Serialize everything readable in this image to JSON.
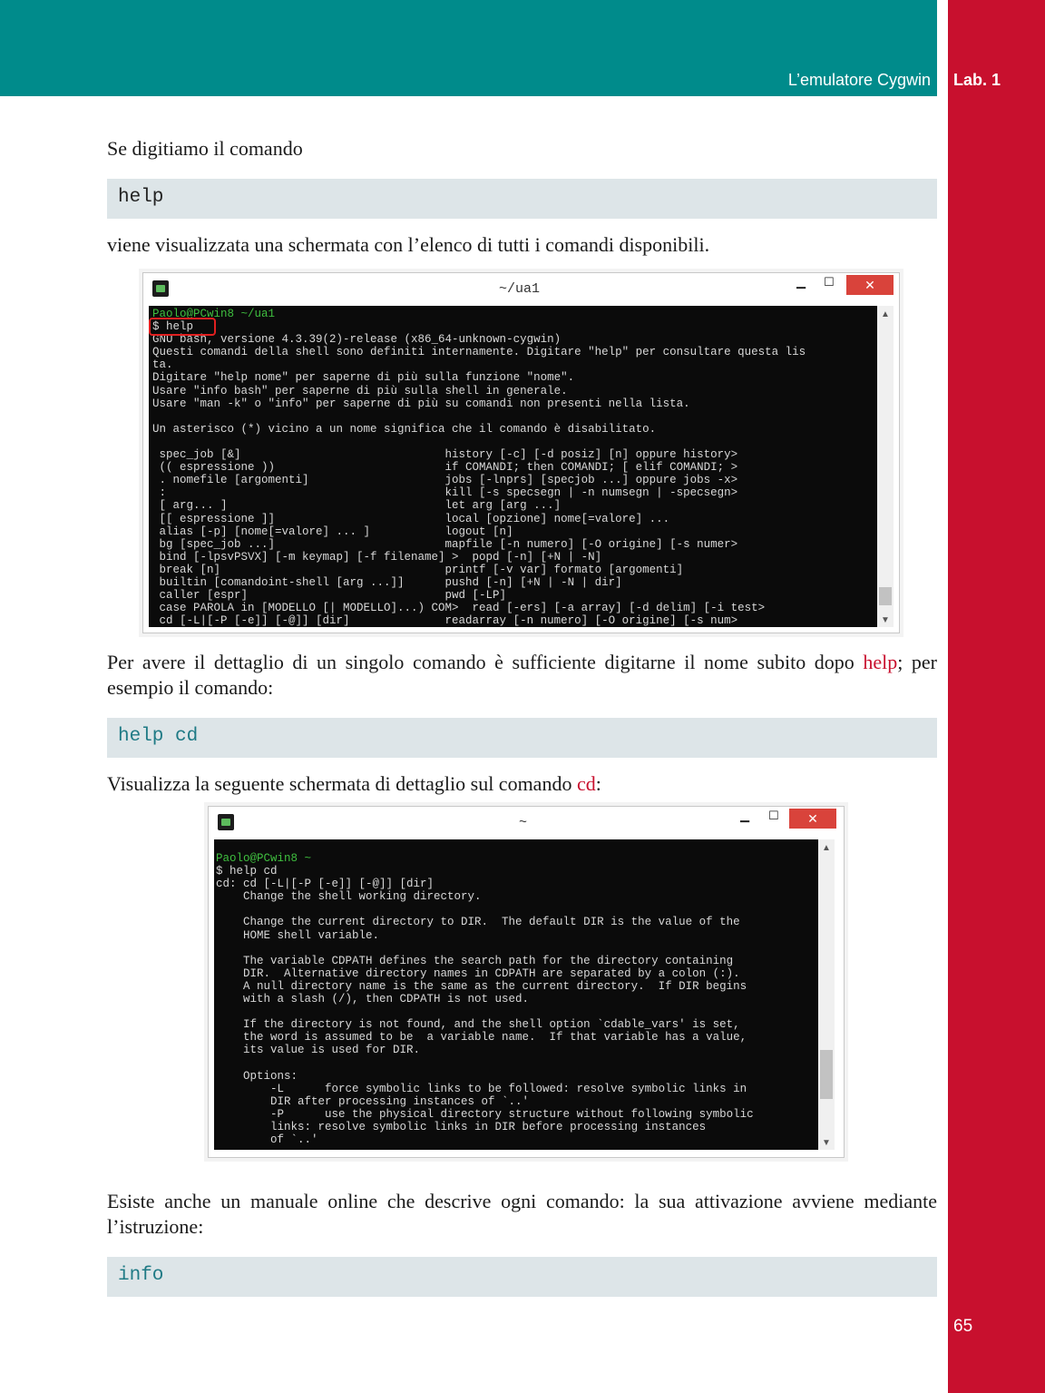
{
  "header": {
    "chapter_title": "L’emulatore Cygwin",
    "lab_label": "Lab. 1",
    "page_number": "65"
  },
  "paragraphs": {
    "p1": "Se digitiamo il comando",
    "p2": "viene visualizzata una schermata con l’elenco di tutti i comandi disponibili.",
    "p3_before": "Per avere il dettaglio di un singolo comando è sufficiente digitarne il nome subito dopo ",
    "p3_keyword": "help",
    "p3_after": "; per esempio il comando:",
    "p4_before": "Visualizza la seguente schermata di dettaglio sul comando ",
    "p4_keyword": "cd",
    "p4_after": ":",
    "p5": "Esiste anche un manuale online che descrive ogni comando: la sua attivazione avviene mediante l’istruzione:"
  },
  "code": {
    "c1": "help",
    "c2": "help cd",
    "c3": "info"
  },
  "window1": {
    "title": "~/ua1",
    "minimize": "▁",
    "maximize": "☐",
    "close": "✕",
    "prompt": "Paolo@PCwin8 ~/ua1",
    "console_text": "$ help\nGNU bash, versione 4.3.39(2)-release (x86_64-unknown-cygwin)\nQuesti comandi della shell sono definiti internamente. Digitare \"help\" per consultare questa lis\nta.\nDigitare \"help nome\" per saperne di più sulla funzione \"nome\".\nUsare \"info bash\" per saperne di più sulla shell in generale.\nUsare \"man -k\" o \"info\" per saperne di più su comandi non presenti nella lista.\n\nUn asterisco (*) vicino a un nome significa che il comando è disabilitato.\n\n spec_job [&]                              history [-c] [-d posiz] [n] oppure history>\n (( espressione ))                         if COMANDI; then COMANDI; [ elif COMANDI; >\n . nomefile [argomenti]                    jobs [-lnprs] [specjob ...] oppure jobs -x>\n :                                         kill [-s specsegn | -n numsegn | -specsegn>\n [ arg... ]                                let arg [arg ...]\n [[ espressione ]]                         local [opzione] nome[=valore] ...\n alias [-p] [nome[=valore] ... ]           logout [n]\n bg [spec_job ...]                         mapfile [-n numero] [-O origine] [-s numer>\n bind [-lpsvPSVX] [-m keymap] [-f filename] >  popd [-n] [+N | -N]\n break [n]                                 printf [-v var] formato [argomenti]\n builtin [comandoint-shell [arg ...]]      pushd [-n] [+N | -N | dir]\n caller [espr]                             pwd [-LP]\n case PAROLA in [MODELLO [| MODELLO]...) COM>  read [-ers] [-a array] [-d delim] [-i test>\n cd [-L|[-P [-e]] [-@]] [dir]              readarray [-n numero] [-O origine] [-s num>"
  },
  "window2": {
    "title": "~",
    "minimize": "▁",
    "maximize": "☐",
    "close": "✕",
    "prompt": "Paolo@PCwin8 ~",
    "console_text": "$ help cd\ncd: cd [-L|[-P [-e]] [-@]] [dir]\n    Change the shell working directory.\n\n    Change the current directory to DIR.  The default DIR is the value of the\n    HOME shell variable.\n\n    The variable CDPATH defines the search path for the directory containing\n    DIR.  Alternative directory names in CDPATH are separated by a colon (:).\n    A null directory name is the same as the current directory.  If DIR begins\n    with a slash (/), then CDPATH is not used.\n\n    If the directory is not found, and the shell option `cdable_vars' is set,\n    the word is assumed to be  a variable name.  If that variable has a value,\n    its value is used for DIR.\n\n    Options:\n        -L      force symbolic links to be followed: resolve symbolic links in\n        DIR after processing instances of `..'\n        -P      use the physical directory structure without following symbolic\n        links: resolve symbolic links in DIR before processing instances\n        of `..'"
  },
  "colors": {
    "teal_bar": "#008b8b",
    "red_bar": "#c8102e",
    "code_bg": "#dde5e8",
    "keyword": "#c8102e",
    "prompt_green": "#3fbf3f"
  }
}
